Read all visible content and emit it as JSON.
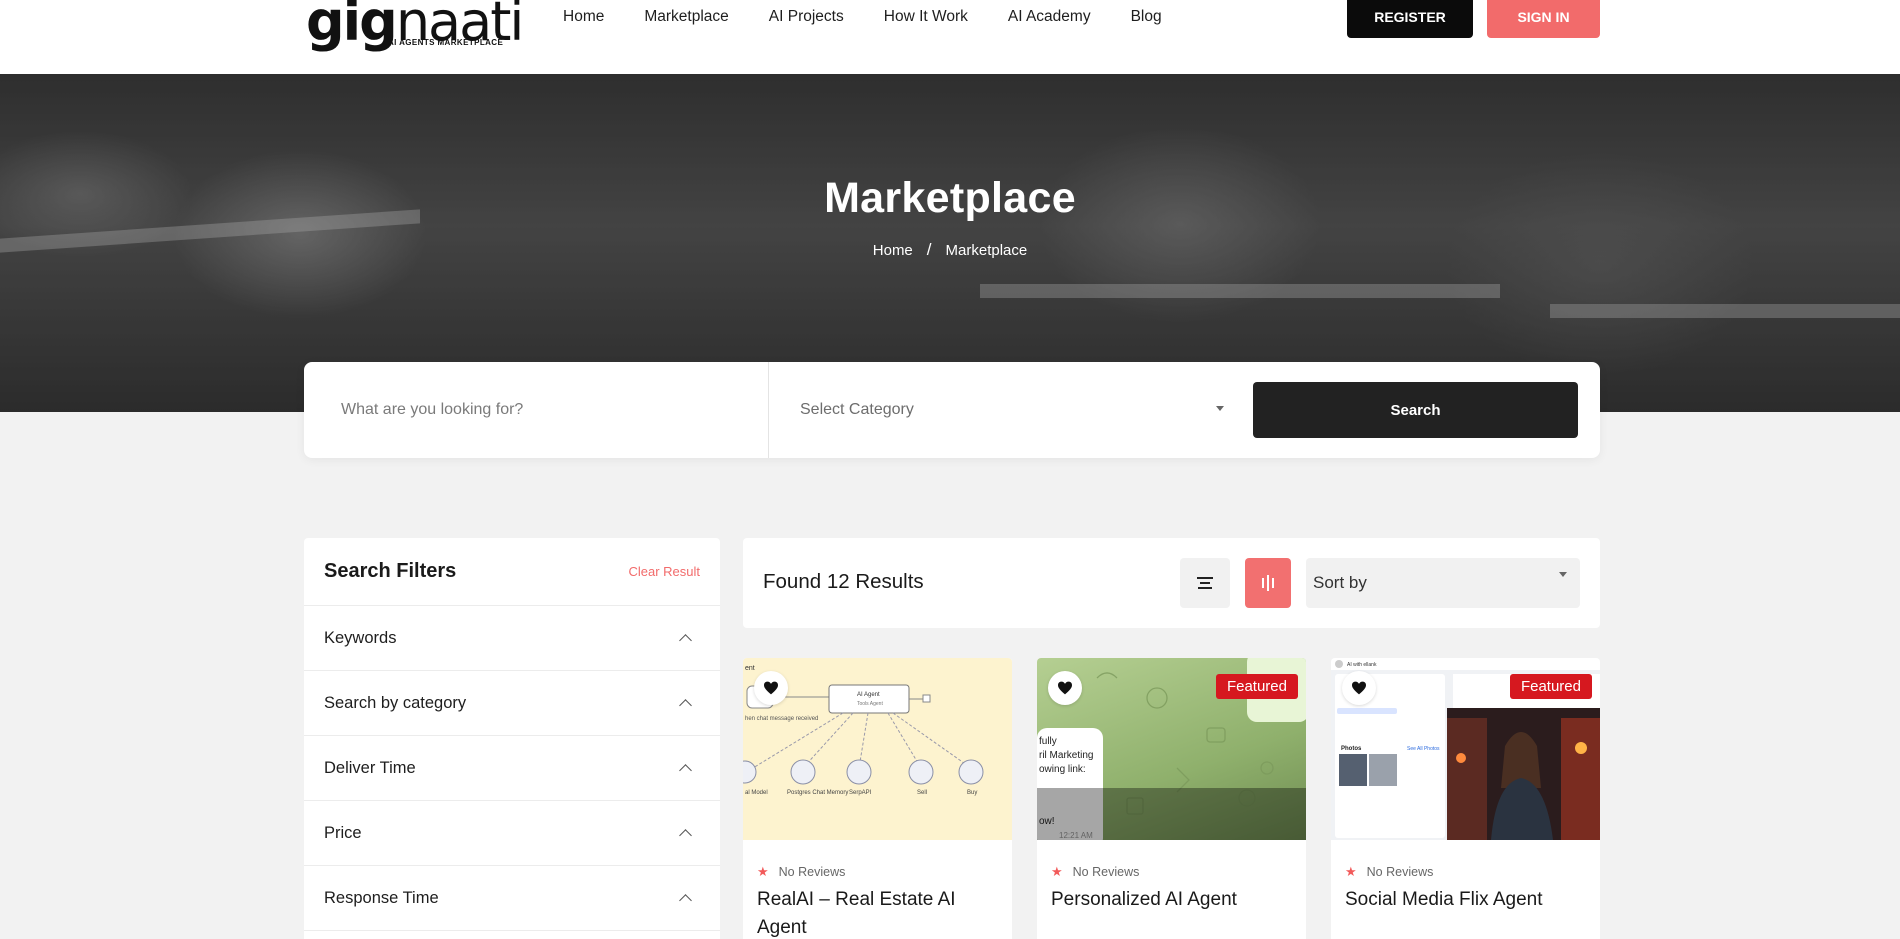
{
  "header": {
    "logo_main": "gig",
    "logo_sub": "naati",
    "logo_tagline": "AI AGENTS MARKETPLACE",
    "nav": [
      "Home",
      "Marketplace",
      "AI Projects",
      "How It Work",
      "AI Academy",
      "Blog"
    ],
    "register_label": "REGISTER",
    "signin_label": "SIGN IN"
  },
  "hero": {
    "title": "Marketplace",
    "breadcrumb": [
      "Home",
      "/",
      "Marketplace"
    ]
  },
  "search": {
    "placeholder": "What are you looking for?",
    "category_placeholder": "Select Category",
    "button_label": "Search"
  },
  "filters": {
    "title": "Search Filters",
    "clear_label": "Clear Result",
    "sections": [
      "Keywords",
      "Search by category",
      "Deliver Time",
      "Price",
      "Response Time"
    ]
  },
  "results": {
    "found_label": "Found 12 Results",
    "sort_placeholder": "Sort by"
  },
  "cards": [
    {
      "title": "RealAI – Real Estate AI Agent",
      "rating": "No Reviews",
      "badge": ""
    },
    {
      "title": "Personalized AI Agent",
      "rating": "No Reviews",
      "badge": "Featured"
    },
    {
      "title": "Social Media Flix Agent",
      "rating": "No Reviews",
      "badge": "Featured"
    }
  ],
  "card1_thumb": {
    "nodes": [
      "AI Agent",
      "Tools Agent",
      "hen chat message received",
      "al Model",
      "Postgres Chat Memory",
      "SerpAPI",
      "Sell",
      "Buy",
      "ent"
    ]
  },
  "card2_thumb": {
    "chat_lines": [
      "fully",
      "ril Marketing",
      "owing link:",
      "ow!",
      "12:21 AM"
    ]
  },
  "card3_thumb": {
    "profile_name": "AI with ellank",
    "photos_label": "Photos",
    "see_all": "See All Photos"
  },
  "colors": {
    "accent": "#f26b6b",
    "dark": "#0b0b0b",
    "badge": "#d6181f"
  }
}
